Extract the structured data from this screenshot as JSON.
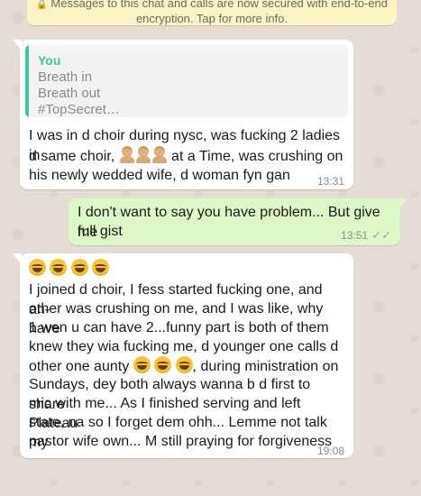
{
  "notice": {
    "line1": "Messages to this chat and calls are now secured with end-to-end",
    "line2": "encryption. Tap for more info.",
    "icon": "lock-icon"
  },
  "messages": [
    {
      "direction": "incoming",
      "quote": {
        "author": "You",
        "lines": [
          "Breath in",
          "Breath out",
          "#TopSecret…"
        ]
      },
      "lines": [
        "I was in d choir during nysc, was fucking 2 ladies in",
        {
          "before": "d same choir, ",
          "after": " at a Time, was crushing on"
        },
        "his newly wedded wife, d woman fyn gan"
      ],
      "time": "13:31"
    },
    {
      "direction": "outgoing",
      "lines": [
        "I don't want to say you have problem... But give me",
        "full gist"
      ],
      "time": "13:51",
      "status": "read"
    },
    {
      "direction": "incoming",
      "lines": [
        "I joined d choir, I fess started fucking one, and an-",
        "other was crushing on me, and I was like, why have",
        "1 wen u can have 2...funny part is both of them",
        "knew they wia fucking me, d younger one calls d",
        {
          "before": "other one aunty ",
          "after": ", during ministration on"
        },
        "Sundays, dey both always wanna b d first to share",
        "mic with me... As I finished serving and left Plateau",
        "state, na so I forget dem ohh... Lemme not talk my",
        "pastor wife own... M still praying for forgiveness"
      ],
      "time": "19:08"
    }
  ],
  "colors": {
    "background": "#e5ddd5",
    "incoming": "#ffffff",
    "outgoing": "#dcf8c6",
    "quote_accent": "#35cd96",
    "notice": "#fdf4c5"
  }
}
